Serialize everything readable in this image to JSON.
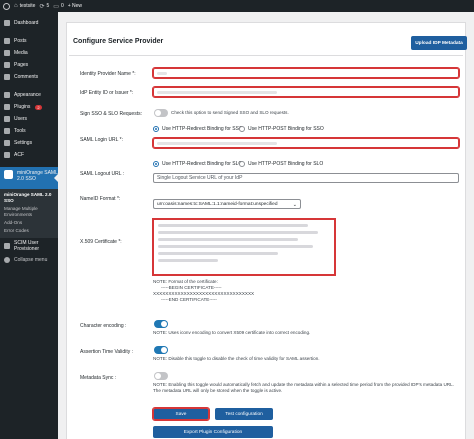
{
  "adminbar": {
    "site_name": "testsite",
    "updates_count": "5",
    "comments_count": "0",
    "new_label": "+ New"
  },
  "sidebar": {
    "items": [
      {
        "label": "Dashboard",
        "icon": "dashboard-icon"
      },
      {
        "label": "Posts",
        "icon": "pin-icon"
      },
      {
        "label": "Media",
        "icon": "media-icon"
      },
      {
        "label": "Pages",
        "icon": "pages-icon"
      },
      {
        "label": "Comments",
        "icon": "comment-icon"
      },
      {
        "label": "Appearance",
        "icon": "brush-icon"
      },
      {
        "label": "Plugins",
        "icon": "plug-icon",
        "badge": "2"
      },
      {
        "label": "Users",
        "icon": "user-icon"
      },
      {
        "label": "Tools",
        "icon": "wrench-icon"
      },
      {
        "label": "Settings",
        "icon": "settings-icon"
      },
      {
        "label": "ACF",
        "icon": "acf-icon"
      }
    ],
    "active": {
      "label": "miniOrange SAML 2.0 SSO",
      "icon": "miniorange-icon"
    },
    "submenu": [
      {
        "label": "miniOrange SAML 2.0 SSO"
      },
      {
        "label": "Manage Multiple Environments"
      },
      {
        "label": "Add-Ons"
      },
      {
        "label": "Error Codes"
      }
    ],
    "scim": {
      "label": "SCIM User Provisioner",
      "icon": "scim-icon"
    },
    "collapse": {
      "label": "Collapse menu",
      "icon": "collapse-icon"
    }
  },
  "panel": {
    "title": "Configure Service Provider",
    "upload_button": "Upload IDP Metadata",
    "fields": {
      "idp_name_label": "Identity Provider Name *:",
      "entity_id_label": "IdP Entity ID or Issuer *:",
      "sign_sso_label": "Sign SSO & SLO Requests:",
      "sign_sso_text": "Check this option to send Signed SSO and SLO requests.",
      "login_url_label": "SAML Login URL *:",
      "login_redirect": "Use HTTP-Redirect Binding for SSO",
      "login_post": "Use HTTP-POST Binding for SSO",
      "logout_url_label": "SAML Logout URL :",
      "logout_redirect": "Use HTTP-Redirect Binding for SLO",
      "logout_post": "Use HTTP-POST Binding for SLO",
      "logout_placeholder": "Single Logout Service URL of your IdP",
      "nameid_label": "NameID Format *:",
      "nameid_value": "urn:oasis:names:tc:SAML:1.1:nameid-format:unspecified",
      "cert_label": "X.509 Certificate *:",
      "cert_note_1": "NOTE: Format of the certificate:",
      "cert_note_2": "-----BEGIN CERTIFICATE-----",
      "cert_note_3": "XXXXXXXXXXXXXXXXXXXXXXXXXXXXXXXXX",
      "cert_note_4": "-----END CERTIFICATE-----",
      "encoding_label": "Character encoding :",
      "encoding_note": "NOTE: Uses iconv encoding to convert X509 certificate into correct encoding.",
      "assertion_label": "Assertion Time Validity :",
      "assertion_note": "NOTE: Disable this toggle to disable the check of time validity for SAML assertion.",
      "metadata_label": "Metadata Sync :",
      "metadata_note": "NOTE: Enabling this toggle would automatically fetch and update the metadata within a selected time period from the provided IDP's metadata URL. The metadata URL will only be stored when the toggle is active."
    },
    "save_button": "Save",
    "test_button": "Test configuration",
    "export_button": "Export Plugin Configuration"
  },
  "colors": {
    "accent": "#1f5f9f",
    "required_border": "#d63638",
    "sidebar_bg": "#1d2327",
    "active_bg": "#2271b1"
  }
}
